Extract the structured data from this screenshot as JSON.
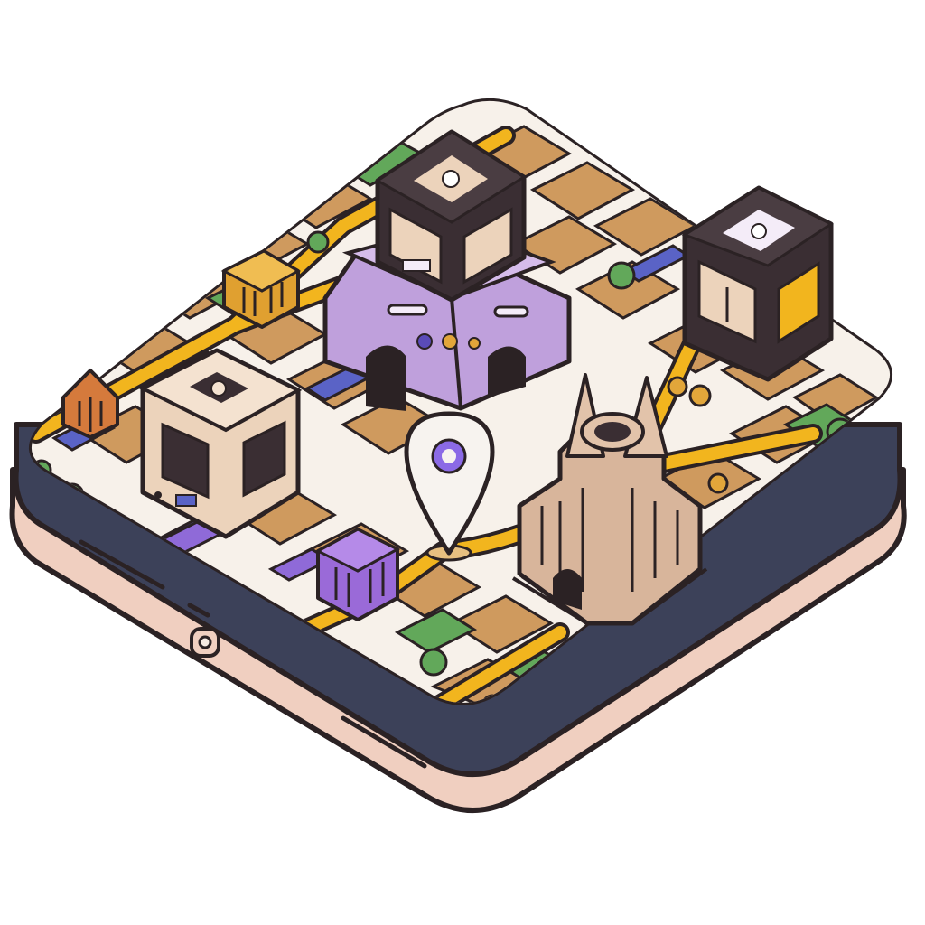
{
  "scene": {
    "subject": "isometric-city-map-tablet",
    "colors": {
      "outline": "#2b2224",
      "device_body": "#3c4159",
      "device_rim": "#f0cfc0",
      "device_top": "#f3e6dc",
      "street": "#f7f1ea",
      "block_sand": "#cf9a5e",
      "block_sand_light": "#dcaa6c",
      "route_yellow": "#f2b51e",
      "park_green": "#62a85a",
      "water_blue": "#5a63c6",
      "district_purple": "#8f6ad8",
      "tower_lilac": "#bfa0dc",
      "printer_dark": "#3a2e33",
      "printer_cream": "#ecd3bb",
      "cathedral_tan": "#d8b59b",
      "kiosk_orange": "#e0a030",
      "kiosk_rust": "#d57a3c",
      "kiosk_purple": "#9a6ad8",
      "pin_white": "#f7f3ef",
      "pin_accent": "#8b6ae6"
    },
    "landmarks": [
      {
        "name": "purple-tower",
        "icon": "tower-icon"
      },
      {
        "name": "dark-printer-top",
        "icon": "3d-printer-icon"
      },
      {
        "name": "dark-printer-right",
        "icon": "3d-printer-icon"
      },
      {
        "name": "cream-printer",
        "icon": "3d-printer-icon"
      },
      {
        "name": "cathedral",
        "icon": "cathedral-icon"
      },
      {
        "name": "location-pin",
        "icon": "map-pin-icon"
      }
    ]
  }
}
